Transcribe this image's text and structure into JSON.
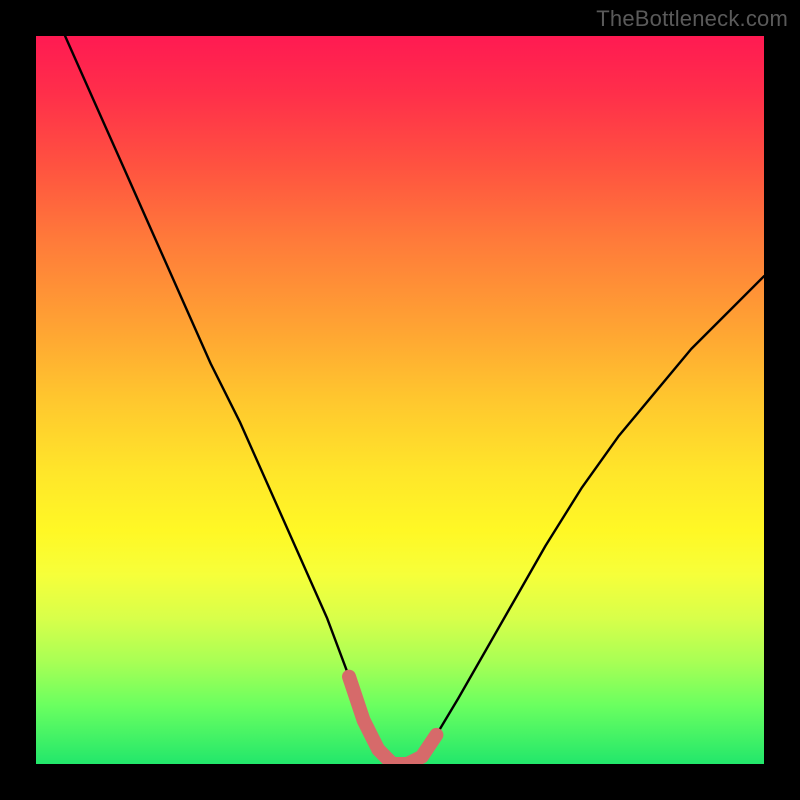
{
  "watermark": "TheBottleneck.com",
  "chart_data": {
    "type": "line",
    "title": "",
    "xlabel": "",
    "ylabel": "",
    "xlim": [
      0,
      100
    ],
    "ylim": [
      0,
      100
    ],
    "series": [
      {
        "name": "bottleneck-curve",
        "x": [
          4,
          8,
          12,
          16,
          20,
          24,
          28,
          32,
          36,
          40,
          43,
          45,
          47,
          49,
          51,
          53,
          55,
          58,
          62,
          66,
          70,
          75,
          80,
          85,
          90,
          95,
          100
        ],
        "values": [
          100,
          91,
          82,
          73,
          64,
          55,
          47,
          38,
          29,
          20,
          12,
          6,
          2,
          0,
          0,
          1,
          4,
          9,
          16,
          23,
          30,
          38,
          45,
          51,
          57,
          62,
          67
        ]
      }
    ],
    "highlight": {
      "name": "optimal-range",
      "x": [
        43,
        45,
        47,
        49,
        51,
        53,
        55
      ],
      "values": [
        12,
        6,
        2,
        0,
        0,
        1,
        4
      ]
    },
    "colors": {
      "curve": "#000000",
      "highlight": "#d66a6a",
      "gradient_top": "#ff1a52",
      "gradient_bottom": "#22e76b"
    }
  }
}
